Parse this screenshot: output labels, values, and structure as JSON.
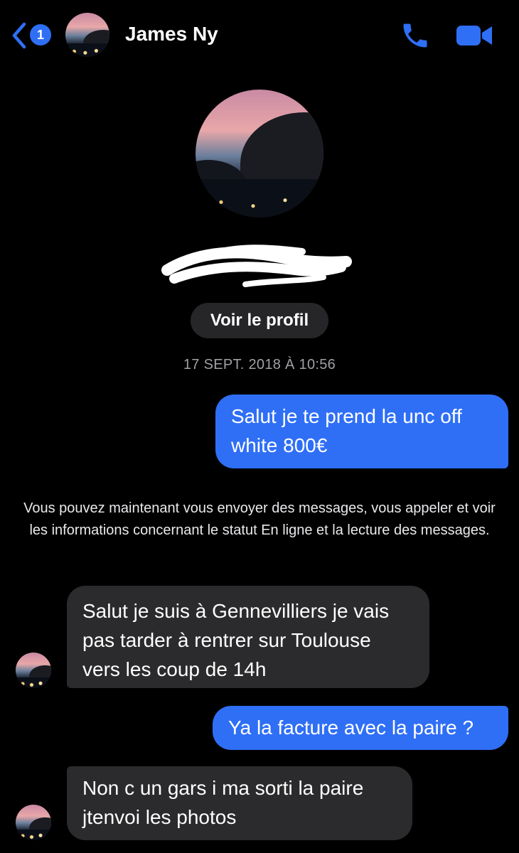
{
  "header": {
    "unread_count": "1",
    "contact_name": "James Ny"
  },
  "icons": {
    "back": "chevron-left-icon",
    "call": "phone-icon",
    "video": "video-camera-icon"
  },
  "colors": {
    "accent": "#2f6ff6",
    "received_bubble": "#2b2b2d",
    "background": "#000000"
  },
  "profile": {
    "view_profile_label": "Voir le profil"
  },
  "conversation": {
    "timestamp": "17 SEPT. 2018 À 10:56",
    "system_note": "Vous pouvez maintenant vous envoyer des messages, vous appeler et voir les informations concernant le statut En ligne et la lecture des messages.",
    "messages": [
      {
        "direction": "sent",
        "text": "Salut je te prend la unc off\nwhite 800€"
      },
      {
        "direction": "received",
        "text": "Salut je suis à Gennevilliers je vais\npas tarder à rentrer sur Toulouse\nvers les coup de 14h"
      },
      {
        "direction": "sent",
        "text": "Ya la facture avec la paire ?"
      },
      {
        "direction": "received",
        "text": "Non c un gars i ma sorti la paire\njtenvoi les photos"
      }
    ]
  }
}
